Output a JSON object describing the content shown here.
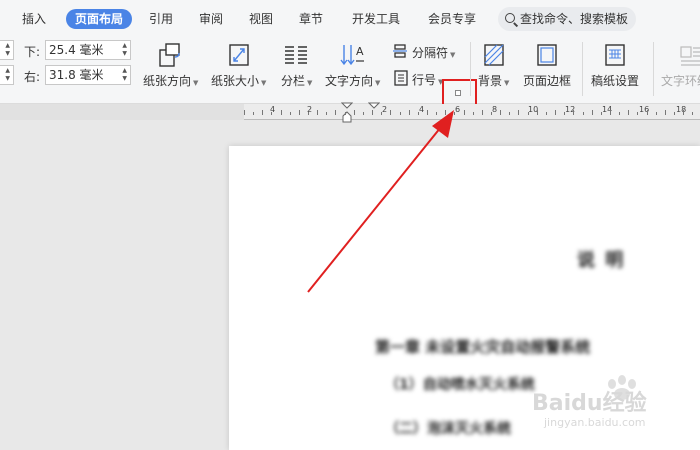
{
  "tabs": [
    {
      "label": "插入",
      "active": false
    },
    {
      "label": "页面布局",
      "active": true
    },
    {
      "label": "引用",
      "active": false
    },
    {
      "label": "审阅",
      "active": false
    },
    {
      "label": "视图",
      "active": false
    },
    {
      "label": "章节",
      "active": false
    },
    {
      "label": "开发工具",
      "active": false
    },
    {
      "label": "会员专享",
      "active": false
    }
  ],
  "search": {
    "label": "查找命令、搜索模板"
  },
  "margins": {
    "bottom_label": "下:",
    "bottom_value": "25.4 毫米",
    "right_label": "右:",
    "right_value": "31.8 毫米"
  },
  "toolbar": {
    "orientation": "纸张方向",
    "size": "纸张大小",
    "columns": "分栏",
    "text_direction": "文字方向",
    "separator": "分隔符",
    "line_number": "行号",
    "background": "背景",
    "page_border": "页面边框",
    "manuscript": "稿纸设置",
    "text_wrap": "文字环绕"
  },
  "ruler": {
    "labels": [
      "4",
      "2",
      "2",
      "4",
      "6",
      "8",
      "10",
      "12",
      "14",
      "16",
      "18"
    ]
  },
  "document": {
    "title": "说    明",
    "lines": [
      "第一章  未设置火灾自动报警系统",
      "（1）自动喷水灭火系统",
      "（二）泡沫灭火系统"
    ]
  },
  "watermark": {
    "brand": "Baidu经验",
    "url": "jingyan.baidu.com"
  },
  "colors": {
    "accent": "#4a84e6",
    "highlight": "#e02020"
  }
}
